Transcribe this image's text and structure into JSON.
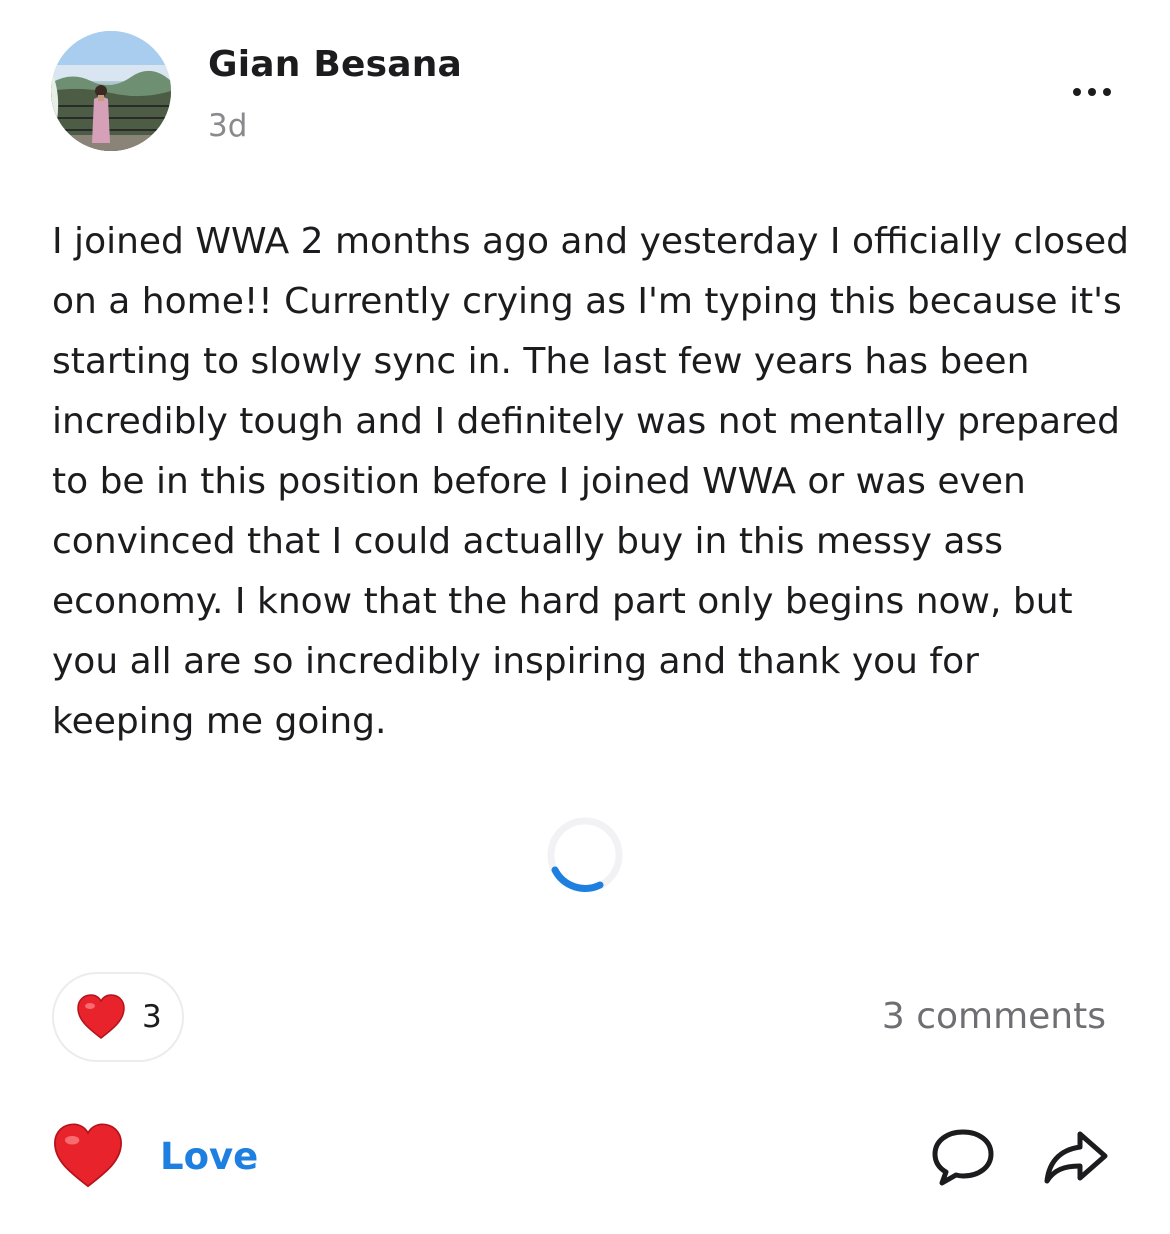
{
  "post": {
    "author": "Gian Besana",
    "time": "3d",
    "text": "I joined WWA 2 months ago and yesterday I officially closed on a home!! Currently crying as I'm typing this because it's starting to slowly sync in. The last few years has been incredibly tough and I definitely was not mentally prepared to be in this position before I joined WWA or was even convinced that I could actually buy in this messy ass economy. I know that the hard part only begins now, but you all are so incredibly inspiring and thank you for keeping me going."
  },
  "reactions": {
    "icon": "heart-icon",
    "count": "3"
  },
  "comments": {
    "label": "3 comments"
  },
  "actions": {
    "love_label": "Love",
    "love_color": "#1d7fe0"
  },
  "icons": [
    "more-options-icon",
    "loading-spinner-icon",
    "heart-icon",
    "comment-bubble-icon",
    "share-arrow-icon"
  ]
}
